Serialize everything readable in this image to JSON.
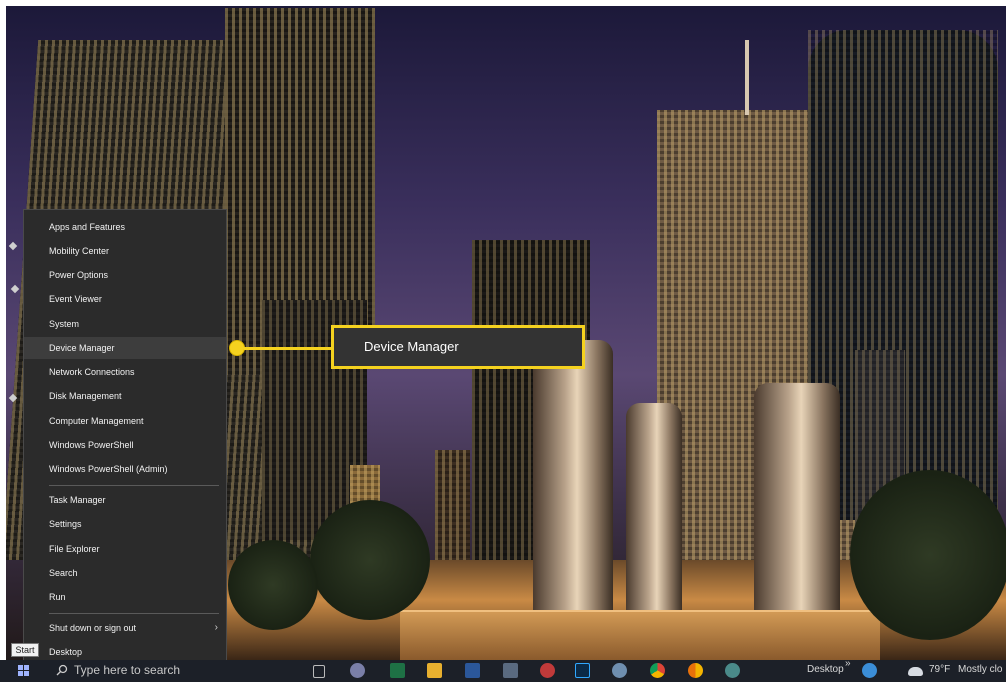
{
  "context_menu": {
    "items": [
      {
        "label": "Apps and Features"
      },
      {
        "label": "Mobility Center"
      },
      {
        "label": "Power Options"
      },
      {
        "label": "Event Viewer"
      },
      {
        "label": "System"
      },
      {
        "label": "Device Manager"
      },
      {
        "label": "Network Connections"
      },
      {
        "label": "Disk Management"
      },
      {
        "label": "Computer Management"
      },
      {
        "label": "Windows PowerShell"
      },
      {
        "label": "Windows PowerShell (Admin)"
      },
      {
        "label": "Task Manager"
      },
      {
        "label": "Settings"
      },
      {
        "label": "File Explorer"
      },
      {
        "label": "Search"
      },
      {
        "label": "Run"
      },
      {
        "label": "Shut down or sign out"
      },
      {
        "label": "Desktop"
      }
    ],
    "highlighted": "Device Manager",
    "submenu_chevron": "›"
  },
  "callout": {
    "label": "Device Manager",
    "color": "#f5d21f"
  },
  "taskbar": {
    "start_tooltip": "Start",
    "search_placeholder": "Type here to search",
    "desktop_label": "Desktop",
    "overflow": "»",
    "weather_temp": "79°F",
    "weather_text": "Mostly clo",
    "icons": [
      "task-view-icon",
      "mail-icon",
      "excel-icon",
      "file-explorer-icon",
      "word-icon",
      "remote-desktop-icon",
      "jump-app-icon",
      "photoshop-icon",
      "paint-icon",
      "chrome-icon",
      "chrome-canary-icon",
      "app-icon"
    ]
  }
}
